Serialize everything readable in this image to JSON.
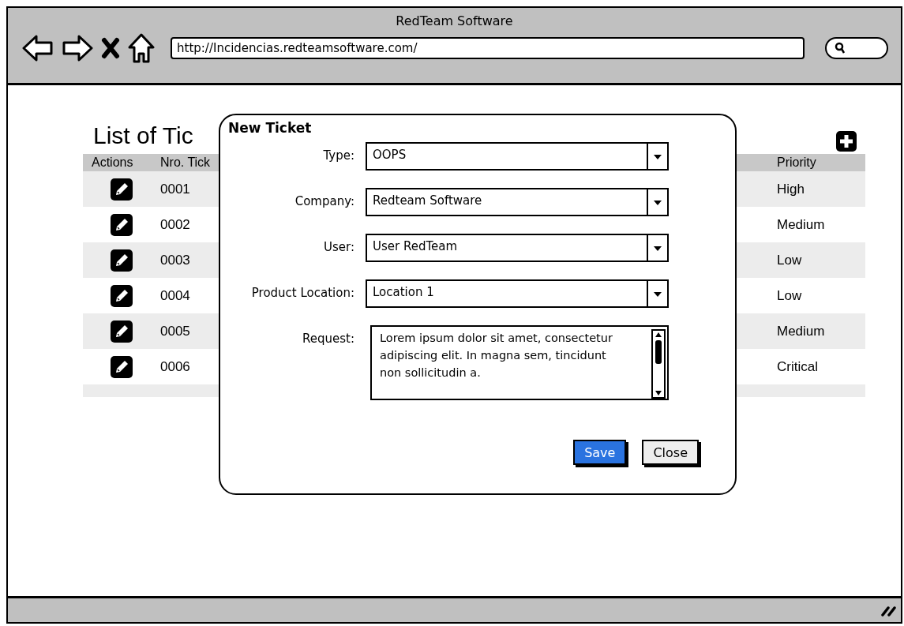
{
  "window": {
    "title": "RedTeam Software"
  },
  "address_bar": {
    "value": "http://Incidencias.redteamsoftware.com/"
  },
  "page": {
    "title": "List of Tic"
  },
  "table": {
    "columns": [
      "Actions",
      "Nro. Tick",
      "Priority"
    ],
    "rows": [
      {
        "number": "0001",
        "priority": "High"
      },
      {
        "number": "0002",
        "priority": "Medium"
      },
      {
        "number": "0003",
        "priority": "Low"
      },
      {
        "number": "0004",
        "priority": "Low"
      },
      {
        "number": "0005",
        "priority": "Medium"
      },
      {
        "number": "0006",
        "priority": "Critical"
      }
    ]
  },
  "dialog": {
    "title": "New Ticket",
    "fields": [
      {
        "kind": "select",
        "label": "Type:",
        "value": "OOPS"
      },
      {
        "kind": "select",
        "label": "Company:",
        "value": "Redteam Software"
      },
      {
        "kind": "select",
        "label": "User:",
        "value": "User RedTeam"
      },
      {
        "kind": "select",
        "label": "Product Location:",
        "value": "Location 1"
      },
      {
        "kind": "textarea",
        "label": "Request:",
        "value": "Lorem ipsum dolor sit amet, consectetur adipiscing elit. In magna sem, tincidunt non sollicitudin a."
      }
    ],
    "buttons": [
      {
        "label": "Save",
        "kind": "primary"
      },
      {
        "label": "Close",
        "kind": "secondary"
      }
    ]
  }
}
